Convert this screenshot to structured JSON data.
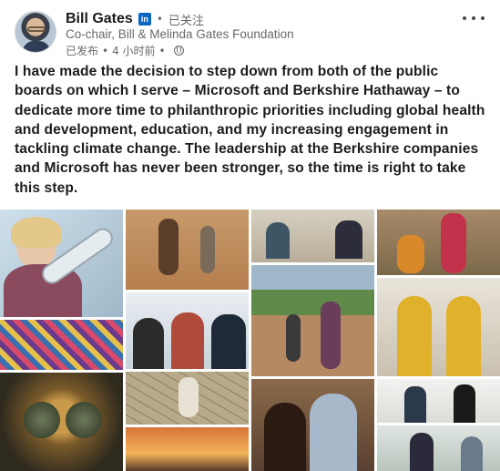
{
  "author": {
    "name": "Bill Gates",
    "network_badge": "in",
    "follow_status": "已关注",
    "headline": "Co-chair, Bill & Melinda Gates Foundation",
    "posted_label": "已发布",
    "time_ago": "4 小时前",
    "visibility_icon": "globe-icon"
  },
  "post": {
    "text": "I have made the decision to step down from both of the public boards on which I serve – Microsoft and Berkshire Hathaway – to dedicate more time to philanthropic priorities including global health and development, education, and my increasing engagement in tackling climate change. The leadership at the Berkshire companies and Microsoft has never been stronger, so the time is right to take this step."
  },
  "menu": {
    "icon": "more-options-icon"
  },
  "colors": {
    "linkedin_blue": "#0a66c2",
    "secondary_text": "#666666"
  }
}
